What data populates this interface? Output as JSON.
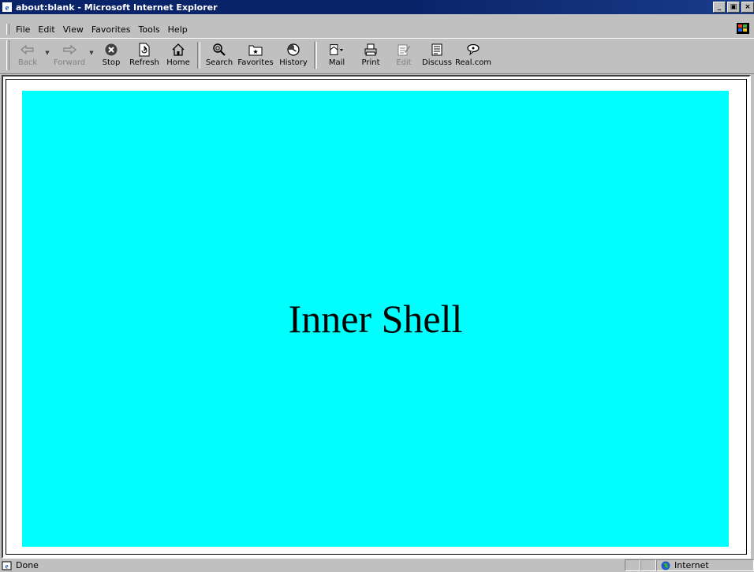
{
  "window": {
    "title": "about:blank - Microsoft Internet Explorer",
    "buttons": {
      "minimize": "_",
      "maximize": "▣",
      "close": "×"
    }
  },
  "menubar": {
    "items": [
      {
        "label": "File"
      },
      {
        "label": "Edit"
      },
      {
        "label": "View"
      },
      {
        "label": "Favorites"
      },
      {
        "label": "Tools"
      },
      {
        "label": "Help"
      }
    ]
  },
  "toolbar": {
    "back": "Back",
    "forward": "Forward",
    "stop": "Stop",
    "refresh": "Refresh",
    "home": "Home",
    "search": "Search",
    "favorites": "Favorites",
    "history": "History",
    "mail": "Mail",
    "print": "Print",
    "edit": "Edit",
    "discuss": "Discuss",
    "realcom": "Real.com"
  },
  "content": {
    "text": "Inner Shell",
    "background": "#00ffff"
  },
  "statusbar": {
    "status": "Done",
    "zone": "Internet"
  },
  "icons": [
    "ie-icon",
    "back-icon",
    "forward-icon",
    "stop-icon",
    "refresh-icon",
    "home-icon",
    "search-icon",
    "favorites-icon",
    "history-icon",
    "mail-icon",
    "print-icon",
    "edit-icon",
    "discuss-icon",
    "realcom-icon",
    "windows-flag-icon",
    "page-icon",
    "globe-icon"
  ]
}
